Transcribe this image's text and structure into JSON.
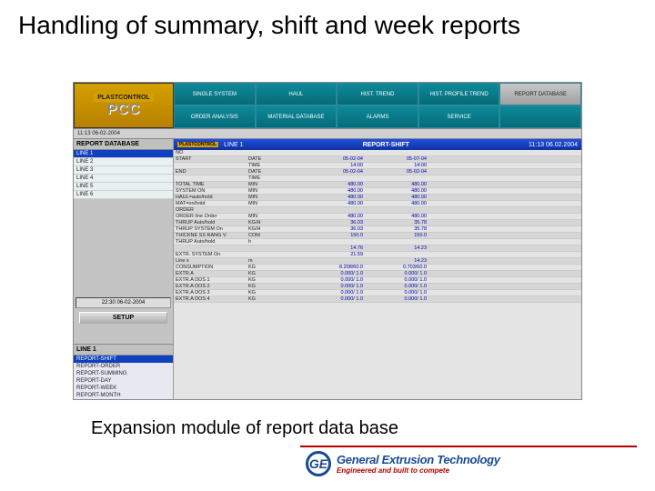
{
  "slide": {
    "title": "Handling of summary, shift and week reports",
    "caption": "Expansion module of report data base"
  },
  "logo": {
    "brand": "PLASTCONTROL",
    "product": "PCC"
  },
  "menu": {
    "row1": [
      "SINGLE SYSTEM",
      "HAUL",
      "HIST. TREND",
      "HIST. PROFILE TREND",
      "REPORT DATABASE"
    ],
    "row2": [
      "ORDER ANALYSIS",
      "MATERIAL DATABASE",
      "ALARMS",
      "SERVICE",
      ""
    ]
  },
  "status_bar": "11:13  06-02-2004",
  "sidebar": {
    "header": "REPORT DATABASE",
    "lines": [
      "LINE 1",
      "LINE 2",
      "LINE 3",
      "LINE 4",
      "LINE 5",
      "LINE 6"
    ],
    "timebox": "22:30 06-02-2004",
    "setup": "SETUP",
    "section2": "LINE 1",
    "reports": [
      "REPORT-SHIFT",
      "REPORT-ORDER",
      "REPORT-SUMMING",
      "REPORT-DAY",
      "REPORT-WEEK",
      "REPORT-MONTH"
    ]
  },
  "pane": {
    "mini_brand": "PLASTCONTROL",
    "line": "LINE 1",
    "title": "REPORT-SHIFT",
    "clock": "11:13 06.02.2004"
  },
  "rows": [
    {
      "l": "NO",
      "v1": "",
      "v2": "",
      "v3": ""
    },
    {
      "l": "START",
      "v1": "DATE",
      "v2": "05-02-04",
      "v3": "05-07-04"
    },
    {
      "l": "",
      "v1": "TIME",
      "v2": "14:00",
      "v3": "14:00"
    },
    {
      "l": "END",
      "v1": "DATE",
      "v2": "05-02-04",
      "v3": "05-02-04"
    },
    {
      "l": "",
      "v1": "TIME",
      "v2": "",
      "v3": ""
    },
    {
      "l": "TOTAL TIME",
      "v1": "MIN",
      "v2": "480.00",
      "v3": "480.00"
    },
    {
      "l": "SYSTEM ON",
      "v1": "MIN",
      "v2": "480.00",
      "v3": "480.00"
    },
    {
      "l": "HAUL=auto/hold",
      "v1": "MIN",
      "v2": "480.00",
      "v3": "480.00"
    },
    {
      "l": "MAT=on/hold",
      "v1": "MIN",
      "v2": "480.00",
      "v3": "480.00"
    },
    {
      "l": "ORDER",
      "v1": "",
      "v2": "",
      "v3": ""
    },
    {
      "l": "ORDER line Order",
      "v1": "MIN",
      "v2": "480.00",
      "v3": "480.00"
    },
    {
      "l": "THRUP Auto/hold",
      "v1": "KG/H",
      "v2": "36.03",
      "v3": "35.78"
    },
    {
      "l": "THRUP SYSTEM On",
      "v1": "KG/H",
      "v2": "36.03",
      "v3": "35.78"
    },
    {
      "l": "THICKNE SS RANG V",
      "v1": "COM",
      "v2": "150.0",
      "v3": "150.0"
    },
    {
      "l": "THRUP Auto/hold",
      "v1": "h",
      "v2": "",
      "v3": ""
    },
    {
      "l": "",
      "v1": "",
      "v2": "14.76",
      "v3": "14.23"
    },
    {
      "l": "EXTR. SYSTEM On",
      "v1": "",
      "v2": "21.59",
      "v3": ""
    },
    {
      "l": "Line s",
      "v1": "m",
      "v2": "",
      "v3": "14.23"
    },
    {
      "l": "CONSUMPTION",
      "v1": "KG",
      "v2": "8.208/60.0",
      "v3": "0.703/60.0"
    },
    {
      "l": "EXTR.A",
      "v1": "KG",
      "v2": "0.000/ 1.0",
      "v3": "0.000/ 1.0"
    },
    {
      "l": "EXTR.A DOS 1",
      "v1": "KG",
      "v2": "0.000/ 1.0",
      "v3": "0.000/ 1.0"
    },
    {
      "l": "EXTR.A DOS 2",
      "v1": "KG",
      "v2": "0.000/ 1.0",
      "v3": "0.000/ 1.0"
    },
    {
      "l": "EXTR.A DOS 3",
      "v1": "KG",
      "v2": "0.000/ 1.0",
      "v3": "0.000/ 1.0"
    },
    {
      "l": "EXTR.A DOS 4",
      "v1": "KG",
      "v2": "0.000/ 1.0",
      "v3": "0.000/ 1.0"
    }
  ],
  "footer": {
    "badge": "GE",
    "line1": "General Extrusion Technology",
    "line2": "Engineered and built to compete"
  }
}
